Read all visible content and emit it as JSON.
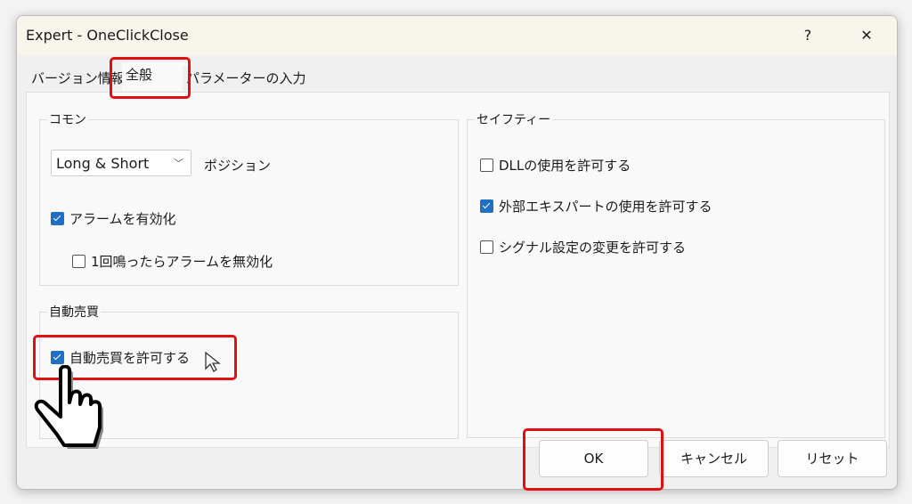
{
  "window": {
    "title": "Expert - OneClickClose",
    "help": "?",
    "close": "✕"
  },
  "tabs": [
    {
      "label": "バージョン情報"
    },
    {
      "label": "全般"
    },
    {
      "label": "パラメーターの入力"
    }
  ],
  "common": {
    "label": "コモン",
    "position_select": "Long & Short",
    "position_label": "ポジション",
    "enable_alert": {
      "label": "アラームを有効化",
      "checked": true
    },
    "disable_alert_once": {
      "label": "1回鳴ったらアラームを無効化",
      "checked": false
    }
  },
  "auto_trade": {
    "label": "自動売買",
    "allow": {
      "label": "自動売買を許可する",
      "checked": true
    }
  },
  "safety": {
    "label": "セイフティー",
    "dll": {
      "label": "DLLの使用を許可する",
      "checked": false
    },
    "external": {
      "label": "外部エキスパートの使用を許可する",
      "checked": true
    },
    "signal": {
      "label": "シグナル設定の変更を許可する",
      "checked": false
    }
  },
  "buttons": {
    "ok": "OK",
    "cancel": "キャンセル",
    "reset": "リセット"
  },
  "colors": {
    "highlight": "#e01010",
    "checkbox": "#1f6fc5"
  }
}
